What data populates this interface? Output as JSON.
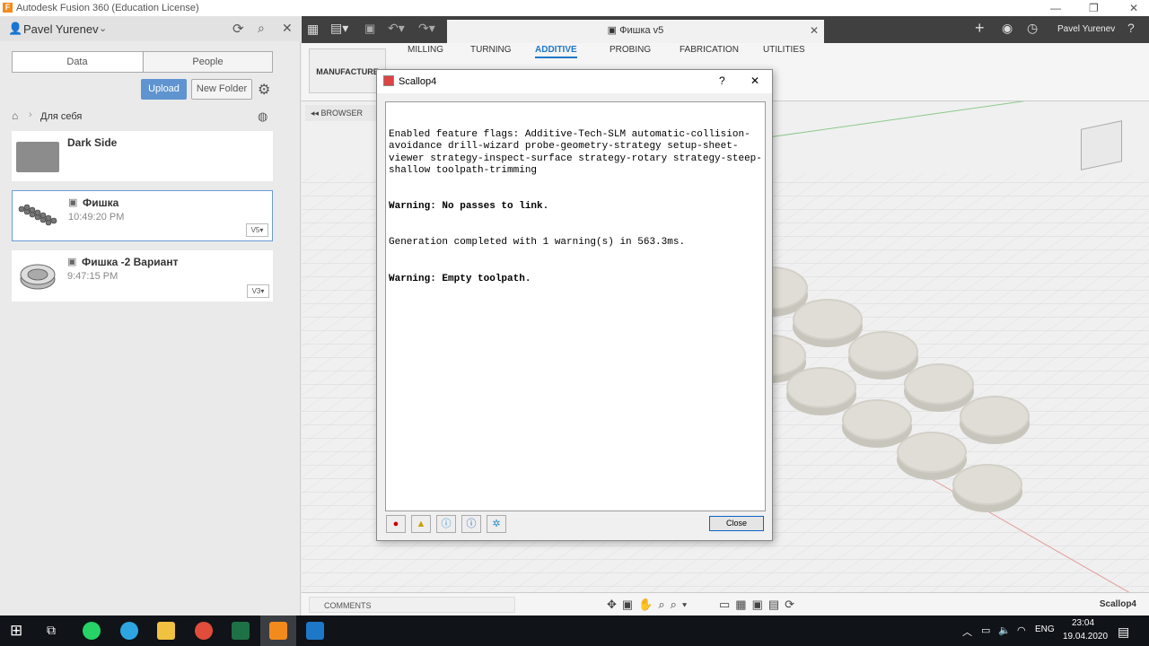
{
  "window": {
    "title": "Autodesk Fusion 360 (Education License)"
  },
  "left_panel": {
    "user": "Pavel Yurenev",
    "tabs": [
      "Data",
      "People"
    ],
    "upload_label": "Upload",
    "new_folder_label": "New Folder",
    "breadcrumb": "Для себя",
    "items": [
      {
        "name": "Dark Side",
        "time": "",
        "version": ""
      },
      {
        "name": "Фишка",
        "time": "10:49:20 PM",
        "version": "V5"
      },
      {
        "name": "Фишка -2 Вариант",
        "time": "9:47:15 PM",
        "version": "V3"
      }
    ]
  },
  "toolbar": {
    "doc_tab": "Фишка v5",
    "user": "Pavel Yurenev"
  },
  "ribbon": {
    "workspace": "MANUFACTURE",
    "tabs": [
      "MILLING",
      "TURNING",
      "ADDITIVE",
      "PROBING",
      "FABRICATION",
      "UTILITIES"
    ],
    "active_tab": "ADDITIVE"
  },
  "browser": {
    "label": "BROWSER"
  },
  "dialog": {
    "title": "Scallop4",
    "help": "?",
    "close_x": "✕",
    "lines": [
      {
        "text": "Enabled feature flags: Additive-Tech-SLM automatic-collision-avoidance drill-wizard probe-geometry-strategy setup-sheet-viewer strategy-inspect-surface strategy-rotary strategy-steep-shallow toolpath-trimming",
        "bold": false
      },
      {
        "text": "Warning: No passes to link.",
        "bold": true
      },
      {
        "text": "Generation completed with 1 warning(s) in 563.3ms.",
        "bold": false
      },
      {
        "text": "Warning: Empty toolpath.",
        "bold": true
      }
    ],
    "close_label": "Close"
  },
  "bottom": {
    "comments": "COMMENTS",
    "status_name": "Scallop4"
  },
  "taskbar": {
    "time": "23:04",
    "date": "19.04.2020",
    "lang": "ENG"
  },
  "colors": {
    "accent": "#1e78c8",
    "upload": "#5f94d0",
    "toolbar": "#404040"
  }
}
